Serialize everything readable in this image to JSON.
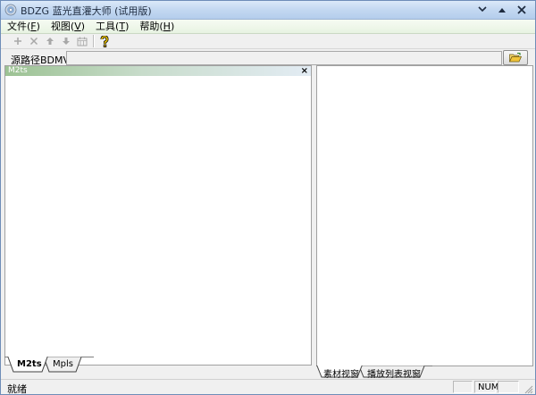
{
  "window": {
    "title": "BDZG 蓝光直灌大师 (试用版)",
    "controls": [
      "minimize",
      "maximize",
      "close"
    ]
  },
  "menubar": {
    "items": [
      {
        "label": "文件",
        "accel": "F"
      },
      {
        "label": "视图",
        "accel": "V"
      },
      {
        "label": "工具",
        "accel": "T"
      },
      {
        "label": "帮助",
        "accel": "H"
      }
    ]
  },
  "toolbar": {
    "buttons": [
      {
        "icon": "plus-icon",
        "enabled": false
      },
      {
        "icon": "x-icon",
        "enabled": false
      },
      {
        "icon": "arrow-up-icon",
        "enabled": false
      },
      {
        "icon": "arrow-down-icon",
        "enabled": false
      },
      {
        "icon": "calendar-icon",
        "enabled": false
      },
      {
        "icon": "help-icon",
        "enabled": true
      }
    ]
  },
  "source_path": {
    "label": "源路径BDMV:",
    "value": "",
    "browse_icon": "open-folder-icon"
  },
  "left_pane": {
    "title": "M2ts",
    "close_glyph": "×",
    "tabs": [
      {
        "label": "M2ts",
        "active": true
      },
      {
        "label": "Mpls",
        "active": false
      }
    ]
  },
  "right_pane": {
    "tabs": [
      {
        "label": "素材视窗",
        "active": true
      },
      {
        "label": "播放列表视窗",
        "active": false
      }
    ]
  },
  "statusbar": {
    "text": "就绪",
    "indicator": "NUM"
  },
  "colors": {
    "title_gradient_start": "#dbe9f9",
    "pane_header_green": "#9cc293",
    "menubar_bg": "#e8f3e2",
    "help_icon_yellow": "#e8c000"
  }
}
